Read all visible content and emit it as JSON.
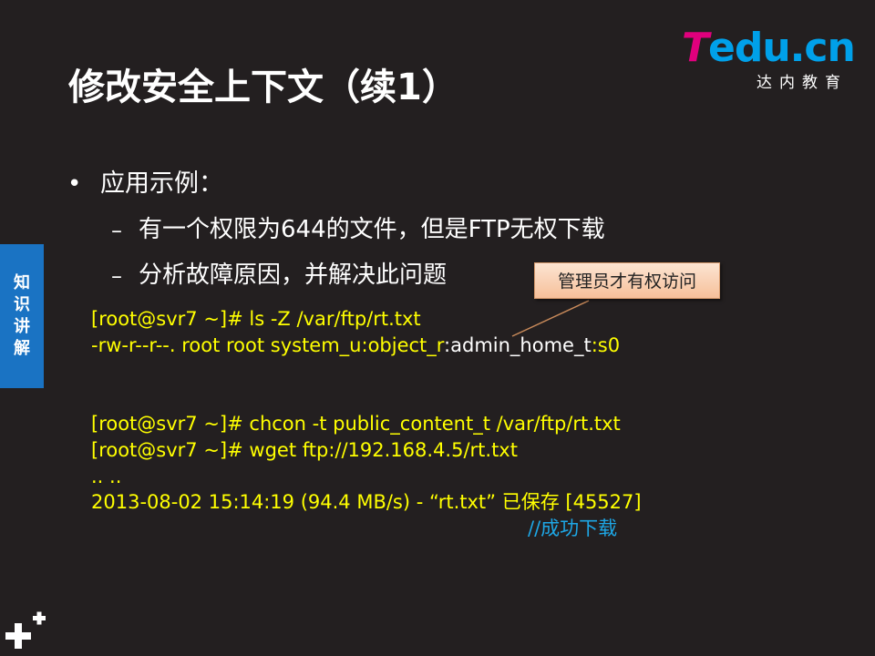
{
  "logo": {
    "mark_first": "T",
    "mark_rest": "edu.cn",
    "subtitle": "达内教育"
  },
  "title": "修改安全上下文（续1）",
  "bullet": {
    "text": "应用示例："
  },
  "sub_items": [
    {
      "dash": "–",
      "text": "有一个权限为644的文件，但是FTP无权下载"
    },
    {
      "dash": "–",
      "text": "分析故障原因，并解决此问题"
    }
  ],
  "callout": {
    "text": "管理员才有权访问"
  },
  "code": {
    "line1": "[root@svr7 ~]# ls  -Z  /var/ftp/rt.txt",
    "line2_a": "-rw-r--r--. root root system_u:object_r",
    "line2_b": ":admin_home_t",
    "line2_c": ":s0",
    "line3": "[root@svr7 ~]# chcon  -t  public_content_t  /var/ftp/rt.txt",
    "line4": "[root@svr7 ~]# wget ftp://192.168.4.5/rt.txt",
    "line5": ".. ..",
    "line6": "2013-08-02 15:14:19 (94.4 MB/s) -  “rt.txt”  已保存 [45527]"
  },
  "comment": "//成功下载",
  "side_tab": [
    "知",
    "识",
    "讲",
    "解"
  ],
  "colors": {
    "background": "#231f20",
    "code": "#ffff00",
    "comment": "#1ea7e6",
    "side_tab": "#1a73c3",
    "logo_pink": "#e0007d",
    "logo_blue": "#00a0e9"
  },
  "icons": {
    "corner": "plus-icon"
  }
}
